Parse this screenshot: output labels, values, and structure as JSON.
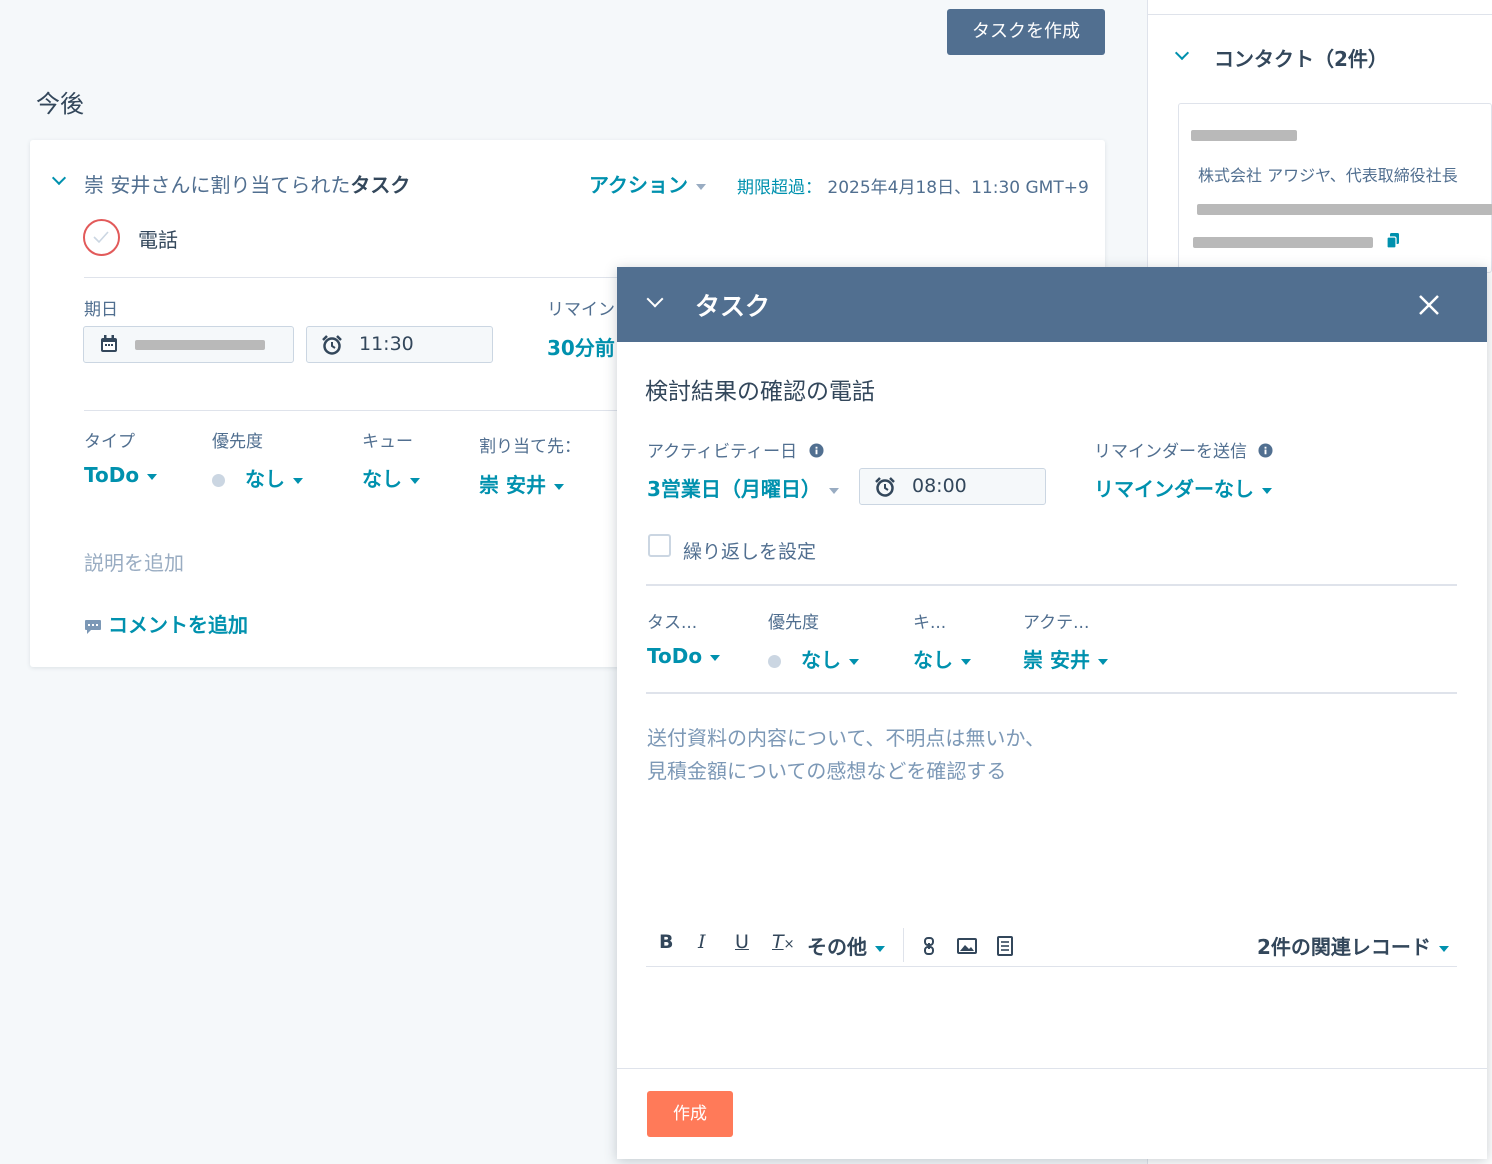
{
  "header": {
    "create_task_button": "タスクを作成"
  },
  "section_title": "今後",
  "task_card": {
    "assigned_prefix": "崇 安井さんに割り当てられた",
    "assigned_bold": "タスク",
    "actions": "アクション",
    "overdue_label": "期限超過：",
    "overdue_value": "2025年4月18日、11:30 GMT+9",
    "task_name": "電話",
    "due_label": "期日",
    "time_value": "11:30",
    "reminder_label": "リマイン",
    "reminder_value": "30分前",
    "type_label": "タイプ",
    "type_value": "ToDo",
    "priority_label": "優先度",
    "priority_value": "なし",
    "queue_label": "キュー",
    "queue_value": "なし",
    "assignee_label": "割り当て先：",
    "assignee_value": "崇 安井",
    "add_description": "説明を追加",
    "add_comment": "コメントを追加"
  },
  "contacts": {
    "title": "コンタクト（2件）",
    "company_line": "株式会社 アワジヤ、代表取締役社長"
  },
  "modal": {
    "header_title": "タスク",
    "task_title": "検討結果の確認の電話",
    "activity_date_label": "アクティビティー日",
    "activity_date_value": "3営業日（月曜日）",
    "activity_time_value": "08:00",
    "reminder_label": "リマインダーを送信",
    "reminder_value": "リマインダーなし",
    "repeat_label": "繰り返しを設定",
    "type_label": "タス...",
    "type_value": "ToDo",
    "priority_label": "優先度",
    "priority_value": "なし",
    "queue_label": "キ...",
    "queue_value": "なし",
    "assignee_label": "アクテ...",
    "assignee_value": "崇 安井",
    "description_line1": "送付資料の内容について、不明点は無いか、",
    "description_line2": "見積金額についての感想などを確認する",
    "toolbar": {
      "bold": "B",
      "italic": "I",
      "underline": "U",
      "clear": "T",
      "more": "その他",
      "associations": "2件の関連レコード"
    },
    "create_button": "作成"
  }
}
